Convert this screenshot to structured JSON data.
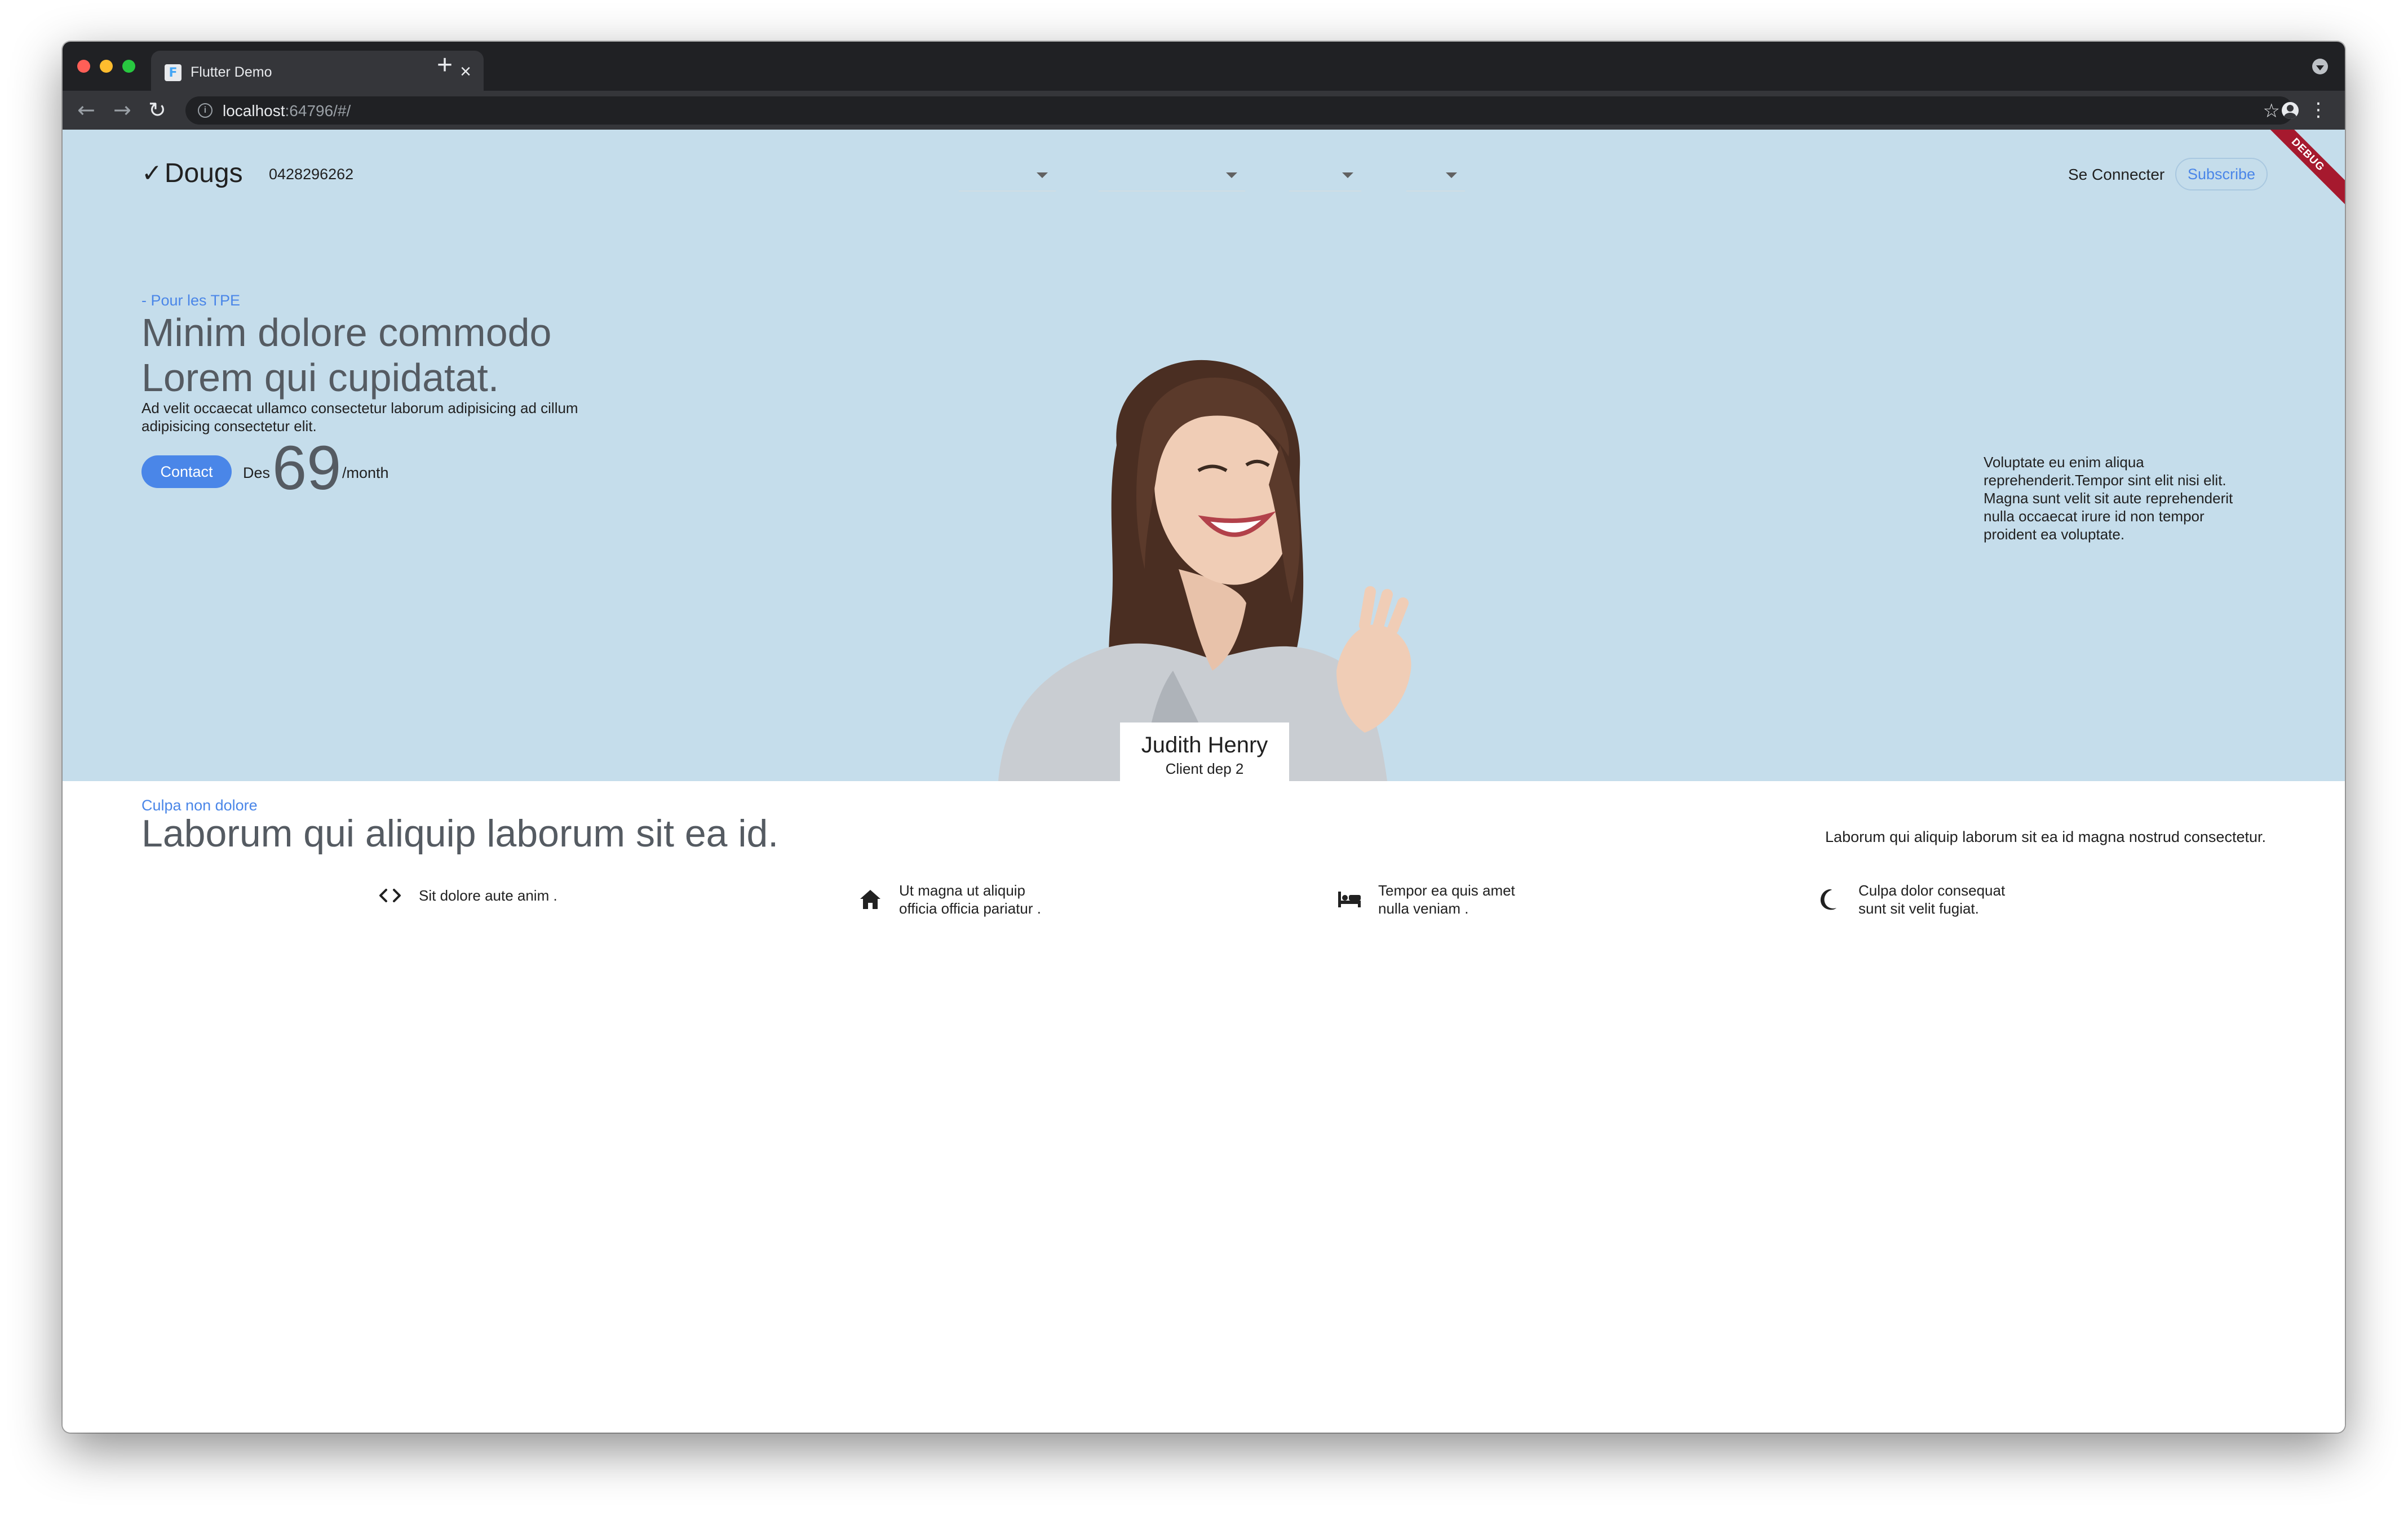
{
  "browser": {
    "tab_title": "Flutter Demo",
    "favicon_glyph": "F",
    "url_host": "localhost",
    "url_rest": ":64796/#/"
  },
  "debug_banner": "DEBUG",
  "header": {
    "brand": "Dougs",
    "phone": "0428296262",
    "login": "Se Connecter",
    "subscribe": "Subscribe"
  },
  "hero": {
    "tag": "- Pour les TPE",
    "title_line1": "Minim dolore commodo",
    "title_line2": "Lorem qui cupidatat.",
    "description": "Ad velit occaecat ullamco consectetur laborum adipisicing ad cillum adipisicing consectetur elit.",
    "contact": "Contact",
    "price_prefix": "Des",
    "price": "69",
    "price_suffix": "/month",
    "right_text": "Voluptate eu enim aliqua reprehenderit.Tempor sint elit nisi elit. Magna sunt velit sit aute reprehenderit nulla occaecat irure id non tempor proident ea voluptate.",
    "client_name": "Judith Henry",
    "client_role": "Client dep 2"
  },
  "section": {
    "tag": "Culpa non dolore",
    "title": "Laborum qui aliquip laborum sit ea id.",
    "right_text": "Laborum qui aliquip laborum sit ea id magna nostrud consectetur."
  },
  "features": [
    {
      "icon": "code-icon",
      "line1": "Sit dolore aute anim .",
      "line2": ""
    },
    {
      "icon": "home-icon",
      "line1": "Ut magna ut aliquip",
      "line2": "officia officia pariatur ."
    },
    {
      "icon": "bed-icon",
      "line1": "Tempor ea quis amet",
      "line2": "nulla veniam ."
    },
    {
      "icon": "moon-icon",
      "line1": "Culpa dolor consequat",
      "line2": "sunt sit velit fugiat."
    }
  ],
  "colors": {
    "hero_bg": "#c5ddeb",
    "accent": "#4a86e8",
    "heading": "#555b62",
    "debug": "#a6192e"
  }
}
